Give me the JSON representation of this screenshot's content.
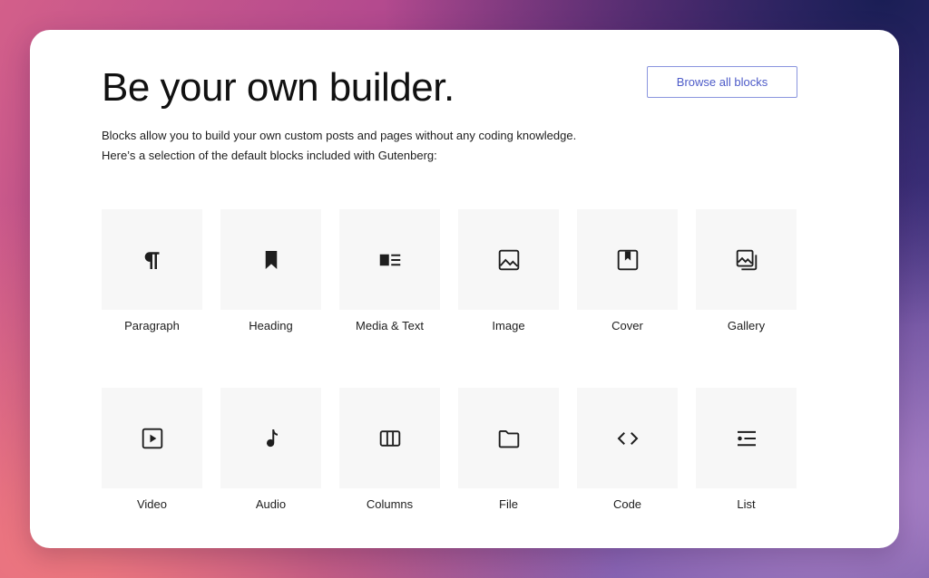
{
  "page": {
    "title": "Be your own builder.",
    "browse_button_label": "Browse all blocks",
    "intro_line_1": "Blocks allow you to build your own custom posts and pages without any coding knowledge.",
    "intro_line_2": "Here’s a selection of the default blocks included with Gutenberg:"
  },
  "blocks": [
    {
      "label": "Paragraph",
      "icon": "paragraph-icon"
    },
    {
      "label": "Heading",
      "icon": "bookmark-icon"
    },
    {
      "label": "Media & Text",
      "icon": "media-text-icon"
    },
    {
      "label": "Image",
      "icon": "image-icon"
    },
    {
      "label": "Cover",
      "icon": "cover-icon"
    },
    {
      "label": "Gallery",
      "icon": "gallery-icon"
    },
    {
      "label": "Video",
      "icon": "video-icon"
    },
    {
      "label": "Audio",
      "icon": "music-note-icon"
    },
    {
      "label": "Columns",
      "icon": "columns-icon"
    },
    {
      "label": "File",
      "icon": "folder-icon"
    },
    {
      "label": "Code",
      "icon": "code-icon"
    },
    {
      "label": "List",
      "icon": "list-icon"
    }
  ],
  "colors": {
    "accent": "#4d5bc8",
    "button_border": "#8a95de",
    "tile_background": "#f7f7f7",
    "text": "#1e1e1e"
  }
}
